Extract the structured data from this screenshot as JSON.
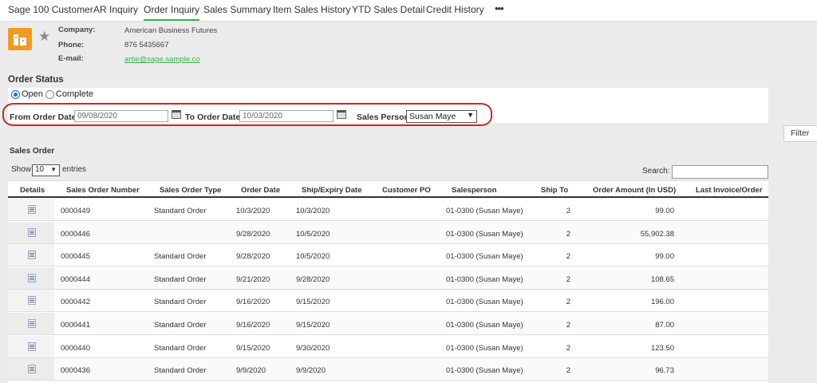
{
  "tabs": [
    {
      "label": "Sage 100 Customer",
      "active": false
    },
    {
      "label": "AR Inquiry",
      "active": false
    },
    {
      "label": "Order Inquiry",
      "active": true
    },
    {
      "label": "Sales Summary",
      "active": false
    },
    {
      "label": "Item Sales History",
      "active": false
    },
    {
      "label": "YTD Sales Detail",
      "active": false
    },
    {
      "label": "Credit History",
      "active": false
    }
  ],
  "more_label": "•••",
  "customer": {
    "company_label": "Company:",
    "company": "American Business Futures",
    "phone_label": "Phone:",
    "phone": "876 5435667",
    "email_label": "E-mail:",
    "email": "artie@sage.sample.co"
  },
  "order_status": {
    "title": "Order Status",
    "options": [
      {
        "label": "Open",
        "selected": true
      },
      {
        "label": "Complete",
        "selected": false
      }
    ],
    "from_label": "From Order Date:",
    "from_value": "09/08/2020",
    "to_label": "To Order Date:",
    "to_value": "10/03/2020",
    "salesperson_label": "Sales Person:",
    "salesperson_value": "Susan Maye"
  },
  "filter_button": "Filter",
  "sales_order": {
    "title": "Sales Order",
    "show_label": "Show",
    "show_value": "10",
    "entries_label": "entries",
    "search_label": "Search:",
    "columns": [
      "Details",
      "Sales Order Number",
      "Sales Order Type",
      "Order Date",
      "Ship/Expiry Date",
      "Customer PO",
      "Salesperson",
      "Ship To",
      "Order Amount (In USD)",
      "Last Invoice/Order"
    ],
    "rows": [
      {
        "number": "0000449",
        "type": "Standard Order",
        "order_date": "10/3/2020",
        "ship_date": "10/3/2020",
        "po": "",
        "salesperson": "01-0300 (Susan Maye)",
        "ship_to": "2",
        "amount": "99.00",
        "last": ""
      },
      {
        "number": "0000446",
        "type": "",
        "order_date": "9/28/2020",
        "ship_date": "10/5/2020",
        "po": "",
        "salesperson": "01-0300 (Susan Maye)",
        "ship_to": "2",
        "amount": "55,902.38",
        "last": ""
      },
      {
        "number": "0000445",
        "type": "Standard Order",
        "order_date": "9/28/2020",
        "ship_date": "10/5/2020",
        "po": "",
        "salesperson": "01-0300 (Susan Maye)",
        "ship_to": "2",
        "amount": "99.00",
        "last": ""
      },
      {
        "number": "0000444",
        "type": "Standard Order",
        "order_date": "9/21/2020",
        "ship_date": "9/28/2020",
        "po": "",
        "salesperson": "01-0300 (Susan Maye)",
        "ship_to": "2",
        "amount": "108.65",
        "last": ""
      },
      {
        "number": "0000442",
        "type": "Standard Order",
        "order_date": "9/16/2020",
        "ship_date": "9/15/2020",
        "po": "",
        "salesperson": "01-0300 (Susan Maye)",
        "ship_to": "2",
        "amount": "196.00",
        "last": ""
      },
      {
        "number": "0000441",
        "type": "Standard Order",
        "order_date": "9/16/2020",
        "ship_date": "9/15/2020",
        "po": "",
        "salesperson": "01-0300 (Susan Maye)",
        "ship_to": "2",
        "amount": "87.00",
        "last": ""
      },
      {
        "number": "0000440",
        "type": "Standard Order",
        "order_date": "9/15/2020",
        "ship_date": "9/30/2020",
        "po": "",
        "salesperson": "01-0300 (Susan Maye)",
        "ship_to": "2",
        "amount": "123.50",
        "last": ""
      },
      {
        "number": "0000436",
        "type": "Standard Order",
        "order_date": "9/9/2020",
        "ship_date": "9/9/2020",
        "po": "",
        "salesperson": "01-0300 (Susan Maye)",
        "ship_to": "2",
        "amount": "96.73",
        "last": ""
      }
    ]
  }
}
